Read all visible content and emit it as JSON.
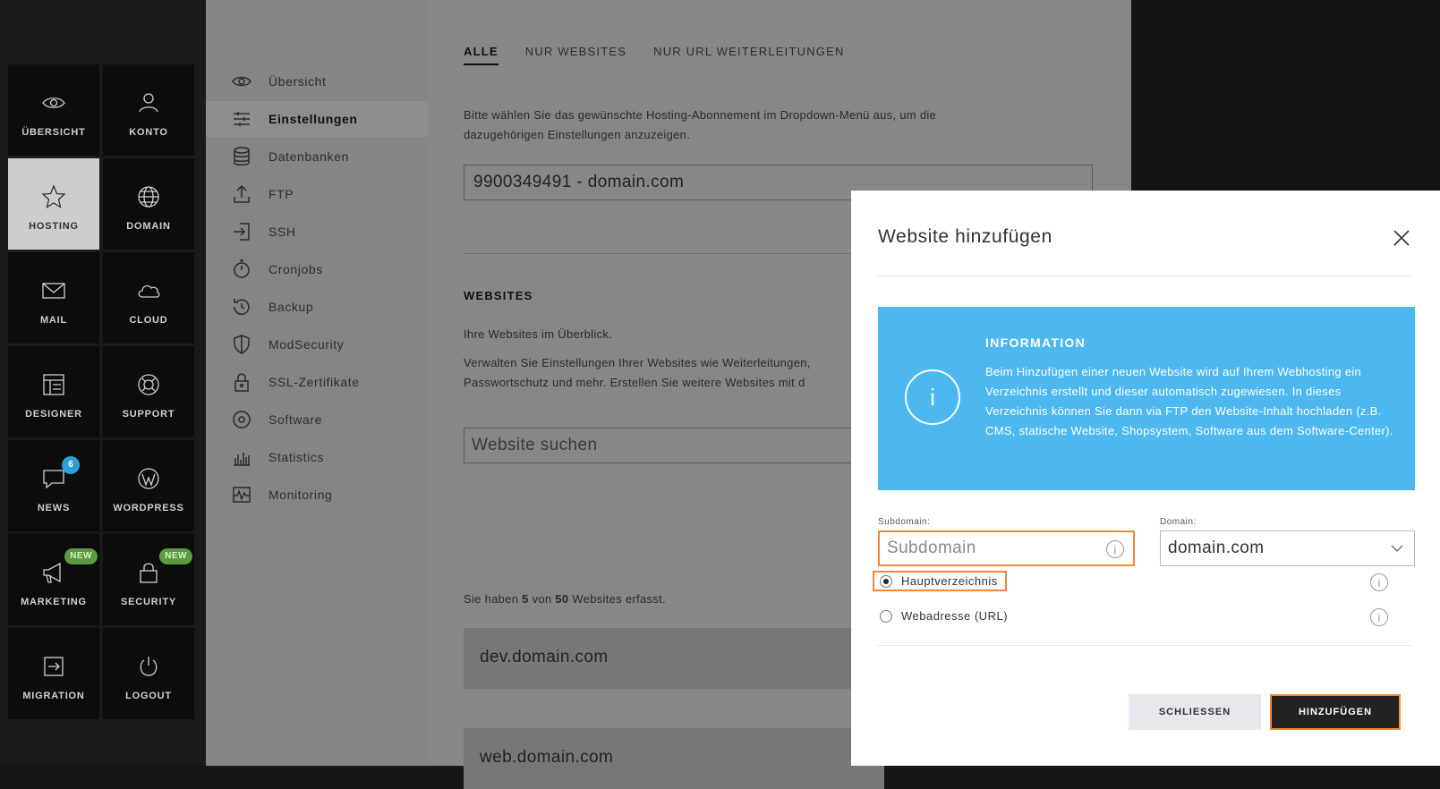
{
  "tiles": [
    {
      "label": "ÜBERSICHT",
      "icon": "eye-icon"
    },
    {
      "label": "KONTO",
      "icon": "user-icon"
    },
    {
      "label": "HOSTING",
      "icon": "star-icon"
    },
    {
      "label": "DOMAIN",
      "icon": "globe-icon"
    },
    {
      "label": "MAIL",
      "icon": "mail-icon"
    },
    {
      "label": "CLOUD",
      "icon": "cloud-icon"
    },
    {
      "label": "DESIGNER",
      "icon": "layout-icon"
    },
    {
      "label": "SUPPORT",
      "icon": "lifebuoy-icon"
    },
    {
      "label": "NEWS",
      "icon": "chat-icon",
      "badge": "6"
    },
    {
      "label": "WORDPRESS",
      "icon": "wordpress-icon"
    },
    {
      "label": "MARKETING",
      "icon": "megaphone-icon",
      "badge": "NEW"
    },
    {
      "label": "SECURITY",
      "icon": "lock-icon",
      "badge": "NEW"
    },
    {
      "label": "MIGRATION",
      "icon": "migration-icon"
    },
    {
      "label": "LOGOUT",
      "icon": "power-icon"
    }
  ],
  "subnav": [
    {
      "label": "Übersicht",
      "icon": "eye-icon"
    },
    {
      "label": "Einstellungen",
      "icon": "sliders-icon"
    },
    {
      "label": "Datenbanken",
      "icon": "database-icon"
    },
    {
      "label": "FTP",
      "icon": "upload-icon"
    },
    {
      "label": "SSH",
      "icon": "login-icon"
    },
    {
      "label": "Cronjobs",
      "icon": "stopwatch-icon"
    },
    {
      "label": "Backup",
      "icon": "history-icon"
    },
    {
      "label": "ModSecurity",
      "icon": "shield-icon"
    },
    {
      "label": "SSL-Zertifikate",
      "icon": "padlock-icon"
    },
    {
      "label": "Software",
      "icon": "circle-icon"
    },
    {
      "label": "Statistics",
      "icon": "barchart-icon"
    },
    {
      "label": "Monitoring",
      "icon": "pulse-icon"
    }
  ],
  "main": {
    "tabs": [
      "ALLE",
      "NUR WEBSITES",
      "NUR URL WEITERLEITUNGEN"
    ],
    "intro": "Bitte wählen Sie das gewünschte Hosting-Abonnement im Dropdown-Menü aus, um die dazugehörigen Einstellungen anzuzeigen.",
    "subscription": "9900349491 - domain.com",
    "websites_title": "WEBSITES",
    "websites_sub": "Ihre Websites im Überblick.",
    "websites_desc_1": "Verwalten Sie Einstellungen Ihrer Websites wie Weiterleitungen,",
    "websites_desc_2": "Passwortschutz und mehr. Erstellen Sie weitere Websites mit d",
    "search_placeholder": "Website suchen",
    "count_prefix": "Sie haben ",
    "count_used": "5",
    "count_mid": " von ",
    "count_total": "50",
    "count_suffix": " Websites erfasst.",
    "sites": [
      "dev.domain.com",
      "web.domain.com"
    ]
  },
  "modal": {
    "title": "Website hinzufügen",
    "info_title": "INFORMATION",
    "info_text": "Beim Hinzufügen einer neuen Website wird auf Ihrem Webhosting ein Verzeichnis erstellt und dieser automatisch zugewiesen. In dieses Verzeichnis können Sie dann via FTP den Website-Inhalt hochladen (z.B. CMS, statische Website, Shopsystem, Software aus dem Software-Center).",
    "subdomain_label": "Subdomain:",
    "subdomain_placeholder": "Subdomain",
    "domain_label": "Domain:",
    "domain_value": "domain.com",
    "radio_main": "Hauptverzeichnis",
    "radio_url": "Webadresse (URL)",
    "close_label": "SCHLIESSEN",
    "add_label": "HINZUFÜGEN"
  },
  "colors": {
    "info_blue": "#4db8f0",
    "highlight_orange": "#f0883a",
    "news_badge": "#2aa0d8",
    "new_badge": "#5b9a3e"
  }
}
